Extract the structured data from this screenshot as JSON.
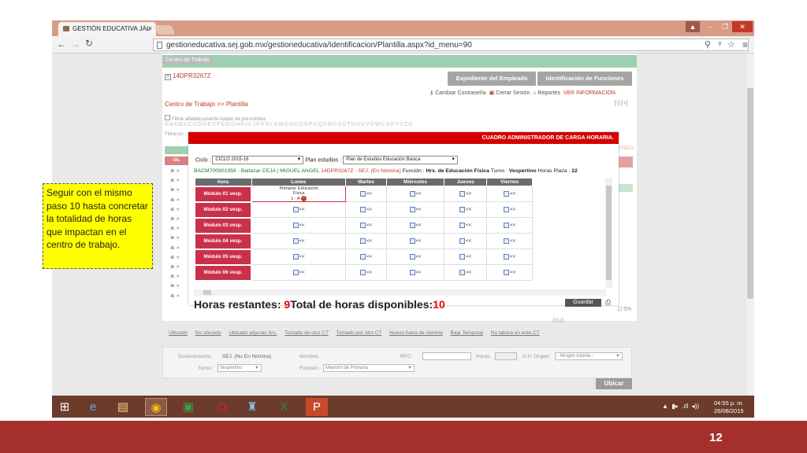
{
  "browser": {
    "tab_title": "GESTIÓN EDUCATIVA JAL",
    "tab_close": "×",
    "url": "gestioneducativa.sej.gob.mx/gestioneducativa/Identificacion/Plantilla.aspx?id_menu=90"
  },
  "site": {
    "green_bar_label": "Centro de Trabajo",
    "ct_code": "14DPR3267Z",
    "buttons": [
      "Expediente del Empleado",
      "Identificación de Funciones"
    ],
    "top_links": [
      "Cambiar Contraseña",
      "Cerrar Sesión",
      "Reportes",
      "VER INFORMACIÓN."
    ],
    "breadcrumb": "Centro de Trabajo >> Plantilla",
    "filter_label": "Filtrar alfabéticamente listado de pre-nómina",
    "alphabet_row": "©A©B©C©D©E©F©G©H©I©J©K©L©M©N©O©P©Q©R©S©T©U©V©W©X©Y©Z©",
    "filter_by": "Filtrar po"
  },
  "modal": {
    "title": "CUADRO ADMINISTRADOR DE CARGA HORARIA.",
    "ciclo_label": "Ciclo :",
    "ciclo_value": "CICLO 2015-16",
    "plan_label": "Plan estudios :",
    "plan_value": "Plan de Estudios Educación Básica",
    "info_code": "BACM700901958",
    "info_name": "Baltazar CEJA | MIGUEL ANGEL",
    "info_ct": "14DPR3267Z - SEJ. (En Nómina)",
    "info_funcion_label": "Función :",
    "info_funcion": "Hrs. de Educación Física",
    "info_turno_label": "Turno :",
    "info_turno": "Vespertino",
    "info_plaza_label": "Horas Plaza :",
    "info_plaza": "22",
    "columns": [
      "hora",
      "Lunes",
      "Martes",
      "Miércoles",
      "Jueves",
      "Viernes"
    ],
    "rows": [
      "Módulo 01 vesp.",
      "Módulo 02 vesp.",
      "Módulo 03 vesp.",
      "Módulo 04 vesp.",
      "Módulo 05 vesp.",
      "Módulo 06 vesp."
    ],
    "cell_text": "<<",
    "assigned_line1": "Primaria: Educación",
    "assigned_line2": "Física",
    "assigned_line3": "1 - A",
    "horas_restantes_label": "Horas restantes: ",
    "horas_restantes": "9",
    "total_label": "Total de horas disponibles:",
    "total": "10",
    "save_label": "Guardar"
  },
  "legend": [
    "Ubicado",
    "No ubicado",
    "Ubicado algunas hrs.",
    "Tomado de otro CT",
    "Tomado por otro CT",
    "Nuevo fuera de nómina",
    "Baja Temporal",
    "No labora en este CT"
  ],
  "form": {
    "sostenimiento_label": "Sostenimiento:",
    "sostenimiento_value": "SEJ. (No En Nómina)",
    "nombre_label": "Nombre:",
    "rfc_label": "RFC:",
    "horas_label": "Horas:",
    "op_label": "O.P. Origen:",
    "op_value": "- Ningún trámite -",
    "turno_label": "Turno:",
    "turno_value": "Vespertino",
    "funcion_label": "Función:",
    "funcion_value": "Maestro de Primaria",
    "ubicar": "Ubicar"
  },
  "callout": "Seguir con el mismo paso 10 hasta concretar la totalidad de horas que impactan en el centro de trabajo.",
  "ghost_text": {
    "fisica": "FISICA",
    "pct": "1) 5%",
    "ina": "ina"
  },
  "taskbar": {
    "time": "04:55 p. m.",
    "date": "26/08/2015"
  },
  "slide_number": "12",
  "colors": {
    "accent_red": "#d40000",
    "hour_cell": "#c9314a",
    "footer": "#a5302b",
    "callout": "#ffff00"
  }
}
